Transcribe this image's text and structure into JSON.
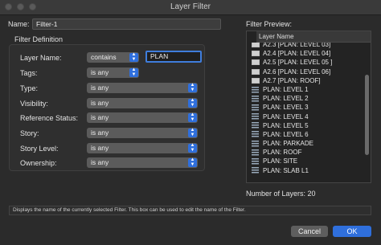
{
  "window": {
    "title": "Layer Filter"
  },
  "name": {
    "label": "Name:",
    "value": "Filter-1"
  },
  "filter_definition": {
    "label": "Filter Definition",
    "rows": [
      {
        "label": "Layer Name:",
        "value": "contains",
        "text_value": "PLAN"
      },
      {
        "label": "Tags:",
        "value": "is any"
      },
      {
        "label": "Type:",
        "value": "is any"
      },
      {
        "label": "Visibility:",
        "value": "is any"
      },
      {
        "label": "Reference Status:",
        "value": "is any"
      },
      {
        "label": "Story:",
        "value": "is any"
      },
      {
        "label": "Story Level:",
        "value": "is any"
      },
      {
        "label": "Ownership:",
        "value": "is any"
      }
    ]
  },
  "filter_preview": {
    "label": "Filter Preview:",
    "column_header": "Layer Name",
    "items": [
      {
        "icon": "sheet-layer-icon",
        "text": "A2.3 [PLAN: LEVEL 03]"
      },
      {
        "icon": "sheet-layer-icon",
        "text": "A2.4 [PLAN: LEVEL 04]"
      },
      {
        "icon": "sheet-layer-icon",
        "text": "A2.5 [PLAN: LEVEL 05 ]"
      },
      {
        "icon": "sheet-layer-icon",
        "text": "A2.6 [PLAN: LEVEL 06]"
      },
      {
        "icon": "sheet-layer-icon",
        "text": "A2.7 [PLAN: ROOF]"
      },
      {
        "icon": "design-layer-icon",
        "text": "PLAN: LEVEL 1"
      },
      {
        "icon": "design-layer-icon",
        "text": "PLAN: LEVEL 2"
      },
      {
        "icon": "design-layer-icon",
        "text": "PLAN: LEVEL 3"
      },
      {
        "icon": "design-layer-icon",
        "text": "PLAN: LEVEL 4"
      },
      {
        "icon": "design-layer-icon",
        "text": "PLAN: LEVEL 5"
      },
      {
        "icon": "design-layer-icon",
        "text": "PLAN: LEVEL 6"
      },
      {
        "icon": "design-layer-icon",
        "text": "PLAN: PARKADE"
      },
      {
        "icon": "design-layer-icon",
        "text": "PLAN: ROOF"
      },
      {
        "icon": "design-layer-icon",
        "text": "PLAN: SITE"
      },
      {
        "icon": "design-layer-icon",
        "text": "PLAN: SLAB L1"
      }
    ]
  },
  "layer_count": "Number of Layers: 20",
  "status_text": "Displays the name of the currently selected Filter. This box can be used to edit the name of the Filter.",
  "buttons": {
    "cancel": "Cancel",
    "ok": "OK"
  },
  "colors": {
    "accent": "#2f6fdc",
    "background": "#2b2b2b"
  }
}
